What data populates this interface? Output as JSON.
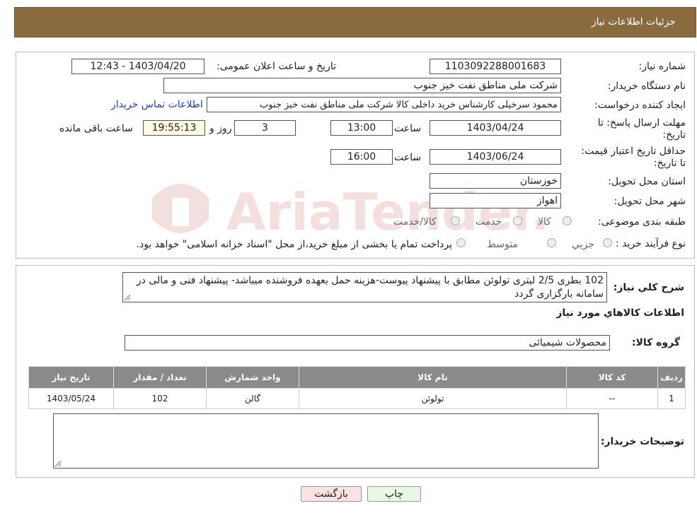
{
  "header": {
    "title": "جزئیات اطلاعات نیاز"
  },
  "form": {
    "need_number": {
      "label": "شماره نیاز:",
      "value": "1103092288001683"
    },
    "announce_datetime": {
      "label": "تاریخ و ساعت اعلان عمومی:",
      "value": "1403/04/20 - 12:43"
    },
    "buyer_org": {
      "label": "نام دستگاه خریدار:",
      "value": "شرکت ملی مناطق نفت خیز جنوب"
    },
    "requester": {
      "label": "ایجاد کننده درخواست:",
      "value": "محمود سرخیلی کارشناس خرید داخلی کالا شرکت ملی مناطق نفت خیز جنوب",
      "contact_link": "اطلاعات تماس خریدار"
    },
    "deadline": {
      "label": "مهلت ارسال پاسخ: تا تاریخ:",
      "date": "1403/04/24",
      "time_label": "ساعت",
      "time": "13:00",
      "days": "3",
      "days_label": "روز و",
      "remaining": "19:55:13",
      "remaining_label": "ساعت باقی مانده"
    },
    "validity": {
      "label": "حداقل تاریخ اعتبار قیمت: تا تاریخ:",
      "date": "1403/06/24",
      "time_label": "ساعت",
      "time": "16:00"
    },
    "province": {
      "label": "استان محل تحویل:",
      "value": "خوزستان"
    },
    "city": {
      "label": "شهر محل تحویل:",
      "value": "اهواز"
    },
    "category": {
      "label": "طبقه بندی موضوعی:",
      "options": [
        "کالا",
        "خدمت",
        "کالا/خدمت"
      ]
    },
    "process": {
      "label": "نوع فرآیند خرید :",
      "options": [
        "جزيي",
        "متوسط"
      ],
      "note": "پرداخت تمام یا بخشی از مبلغ خرید،از محل \"اسناد خزانه اسلامی\" خواهد بود."
    }
  },
  "description": {
    "label": "شرح کلي نياز:",
    "text": "102 بطری 2/5 لیتری تولوئن مطابق با پیشنهاد پیوست-هزینه حمل بعهده فروشنده میباشد- پیشنهاد فنی و مالی در سامانه بارگزاری گردد"
  },
  "goods": {
    "section_title": "اطلاعات کالاهاي مورد نياز",
    "group_label": "گروه کالا:",
    "group_value": "محصولات شیمیائی",
    "columns": [
      "ردیف",
      "کد کالا",
      "نام کالا",
      "واحد شمارش",
      "تعداد / مقدار",
      "تاریخ نیاز"
    ],
    "rows": [
      {
        "row": "1",
        "code": "--",
        "name": "تولوئن",
        "unit": "گالن",
        "qty": "102",
        "date": "1403/05/24"
      }
    ]
  },
  "buyer_notes": {
    "label": "توضیحات خریدار:",
    "value": ""
  },
  "buttons": {
    "print": "چاپ",
    "back": "بازگشت"
  },
  "colors": {
    "header_bg": "#8a6a3f",
    "table_header_bg": "#8a8a8a",
    "link": "#1a3fcc",
    "back_button_bg": "#fbe3e3",
    "print_button_bg": "#e9f8e4"
  }
}
